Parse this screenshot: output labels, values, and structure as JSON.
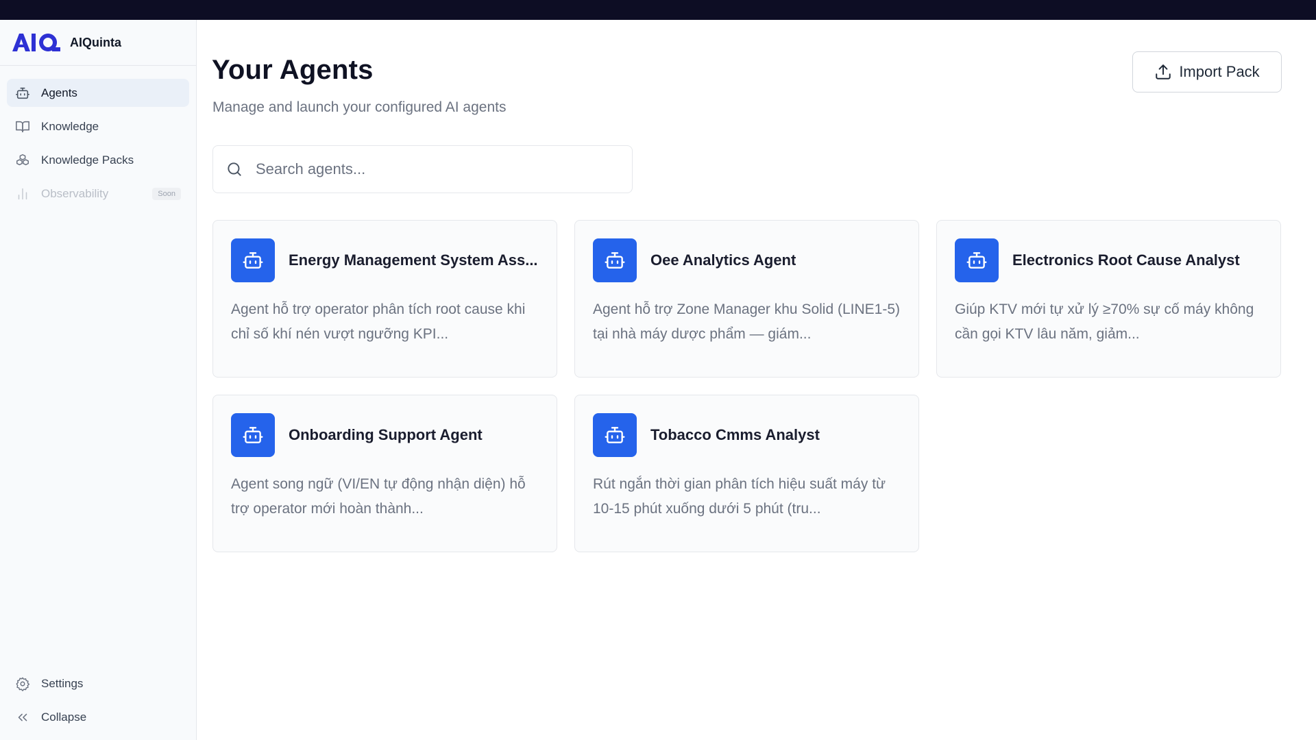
{
  "brand": {
    "logo_text": "AIQ",
    "name": "AIQuinta"
  },
  "sidebar": {
    "items": [
      {
        "label": "Agents",
        "icon": "robot-icon",
        "active": true
      },
      {
        "label": "Knowledge",
        "icon": "book-icon"
      },
      {
        "label": "Knowledge Packs",
        "icon": "boxes-icon"
      },
      {
        "label": "Observability",
        "icon": "bar-chart-icon",
        "disabled": true,
        "badge": "Soon"
      }
    ],
    "bottom": [
      {
        "label": "Settings",
        "icon": "gear-icon"
      },
      {
        "label": "Collapse",
        "icon": "chevrons-left-icon"
      }
    ]
  },
  "header": {
    "title": "Your Agents",
    "subtitle": "Manage and launch your configured AI agents",
    "import_label": "Import Pack"
  },
  "search": {
    "placeholder": "Search agents...",
    "value": ""
  },
  "agents": [
    {
      "name": "Energy Management System Ass...",
      "description": "Agent hỗ trợ operator phân tích root cause khi chỉ số khí nén vượt ngưỡng KPI..."
    },
    {
      "name": "Oee Analytics Agent",
      "description": "Agent hỗ trợ Zone Manager khu Solid (LINE1-5) tại nhà máy dược phẩm — giám..."
    },
    {
      "name": "Electronics Root Cause Analyst",
      "description": "Giúp KTV mới tự xử lý ≥70% sự cố máy không cần gọi KTV lâu năm, giảm..."
    },
    {
      "name": "Onboarding Support Agent",
      "description": "Agent song ngữ (VI/EN tự động nhận diện) hỗ trợ operator mới hoàn thành..."
    },
    {
      "name": "Tobacco Cmms Analyst",
      "description": "Rút ngắn thời gian phân tích hiệu suất máy từ 10-15 phút xuống dưới 5 phút (tru..."
    }
  ],
  "colors": {
    "accent": "#2563eb",
    "topbar": "#0d0d24",
    "sidebar_bg": "#f8fafc",
    "active_bg": "#eaf0f8"
  }
}
